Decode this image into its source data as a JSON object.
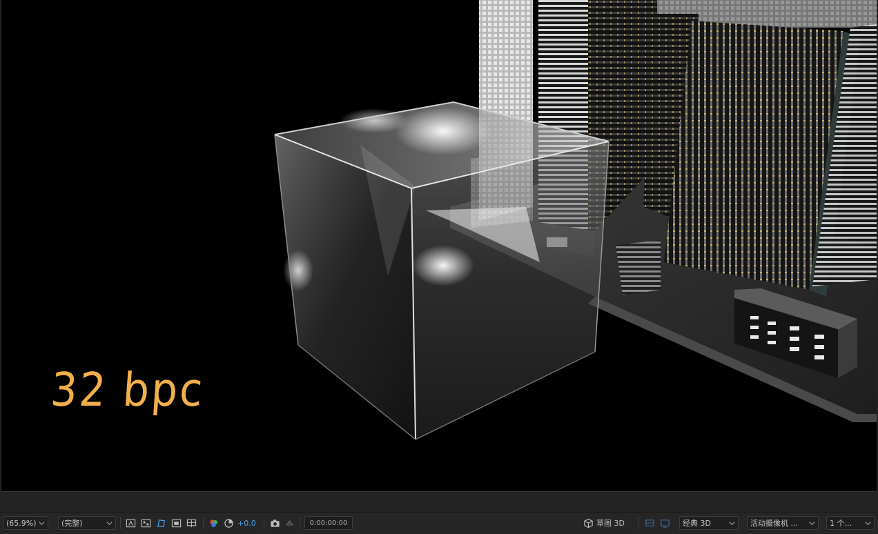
{
  "viewer": {
    "annotation_text": "32 bpc"
  },
  "toolbar": {
    "magnification": "(65.9%)",
    "resolution": "(完整)",
    "exposure_value": "+0.0",
    "timecode": "0:00:00:00",
    "draft3d_label": "草图 3D",
    "renderer": "经典 3D",
    "active_camera": "活动摄像机 ...",
    "views": "1 个..."
  },
  "colors": {
    "annotation": "#f2b04a",
    "exposure_accent": "#4aa3f0",
    "toolbar_bg": "#262626",
    "viewer_bg": "#000000"
  },
  "icons": [
    "chevron-down-icon",
    "snapshot-camera-icon",
    "color-channel-icon",
    "reset-exposure-icon",
    "grid-icon",
    "transparency-grid-icon",
    "mask-path-icon",
    "region-of-interest-icon",
    "fast-preview-icon",
    "draft-3d-cube-icon"
  ]
}
